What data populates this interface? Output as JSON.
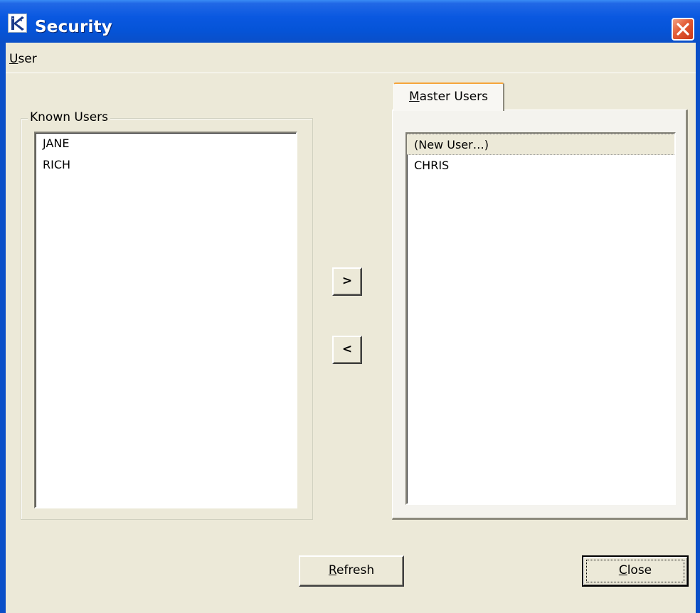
{
  "window": {
    "title": "Security",
    "titlebar_color": "#0a58e0"
  },
  "menu": {
    "items": [
      {
        "label_underlined": "U",
        "label_rest": "ser"
      }
    ]
  },
  "known_users": {
    "label": "Known Users",
    "items": [
      "JANE",
      "RICH"
    ]
  },
  "master_users": {
    "tab_underlined": "M",
    "tab_rest": "aster Users",
    "items": [
      "(New User…)",
      "CHRIS"
    ],
    "selected_index": 0
  },
  "transfer": {
    "move_right_label": ">",
    "move_left_label": "<"
  },
  "buttons": {
    "refresh_underlined": "R",
    "refresh_rest": "efresh",
    "close_underlined": "C",
    "close_rest": "lose"
  },
  "icons": {
    "app": "security-app-icon",
    "close": "close-x-icon"
  }
}
